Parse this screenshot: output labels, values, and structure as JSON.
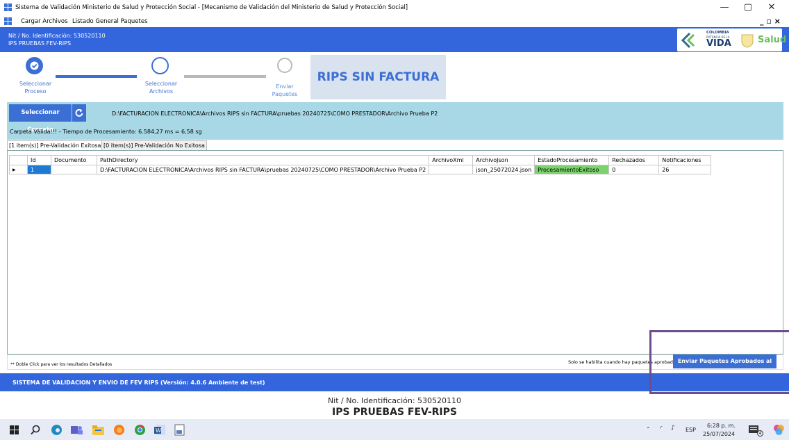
{
  "window": {
    "title": "Sistema de Validación Ministerio de Salud y Protección Social - [Mecanismo de Validación del Ministerio de Salud y Protección Social]",
    "minimize": "—",
    "maximize": "▢",
    "close": "✕"
  },
  "menu": {
    "items": [
      "Cargar Archivos",
      "Listado General Paquetes"
    ],
    "child_controls": "_ ▫ ×"
  },
  "header": {
    "nit": "Nit / No. Identificación: 530520110",
    "ips": "IPS PRUEBAS FEV-RIPS",
    "logo_country": "COLOMBIA",
    "logo_tagline": "POTENCIA DE LA",
    "logo_word": "VIDA",
    "logo_brand": "Salud"
  },
  "wizard": {
    "steps": [
      {
        "label_line1": "Seleccionar",
        "label_line2": "Proceso",
        "state": "done"
      },
      {
        "label_line1": "Seleccionar",
        "label_line2": "Archivos",
        "state": "active"
      },
      {
        "label_line1": "Enviar",
        "label_line2": "Paquetes",
        "state": "pending"
      }
    ],
    "mode_title": "RIPS SIN FACTURA"
  },
  "folder": {
    "select_button": "Seleccionar Carpeta",
    "refresh_icon": "refresh-icon",
    "path": "D:\\FACTURACION ELECTRONICA\\Archivos RIPS sin FACTURA\\pruebas 20240725\\COMO PRESTADOR\\Archivo Prueba P2",
    "status": "Carpeta Válida!!! - Tiempo de Procesamiento: 6.584,27 ms = 6,58 sg"
  },
  "tabs": [
    {
      "label": "[1 item(s)] Pre-Validación Exitosa",
      "active": true
    },
    {
      "label": "[0 item(s)] Pre-Validación No Exitosa",
      "active": false
    }
  ],
  "grid": {
    "columns": [
      "Id",
      "Documento",
      "PathDirectory",
      "ArchivoXml",
      "ArchivoJson",
      "EstadoProcesamiento",
      "Rechazados",
      "Notificaciones"
    ],
    "rows": [
      {
        "id": "1",
        "documento": "",
        "path": "D:\\FACTURACION ELECTRONICA\\Archivos RIPS sin FACTURA\\pruebas 20240725\\COMO PRESTADOR\\Archivo Prueba P2",
        "xml": "",
        "json": "json_25072024.json",
        "estado": "ProcesamientoExitoso",
        "rechazados": "0",
        "notificaciones": "26"
      }
    ]
  },
  "bottom": {
    "hint": "** Doble Click para ver los resultados Detallados",
    "only_hint": "Solo se habilita cuando hay paquetes aprobados",
    "send_button": "Enviar Paquetes Aprobados al"
  },
  "footer": {
    "system": "SISTEMA DE VALIDACION Y ENVIO DE FEV RIPS  (Versión: 4.0.6 Ambiente de test)",
    "nit": "Nit / No. Identificación: 530520110",
    "ips": "IPS PRUEBAS FEV-RIPS"
  },
  "taskbar": {
    "lang": "ESP",
    "time": "6:28 p. m.",
    "date": "25/07/2024",
    "notif_count": "4"
  },
  "colors": {
    "brand_blue": "#3366dd",
    "accent": "#3b6fd4",
    "band": "#a8d8e6",
    "success": "#7bd46b",
    "highlight_box": "#6a4d8d"
  }
}
